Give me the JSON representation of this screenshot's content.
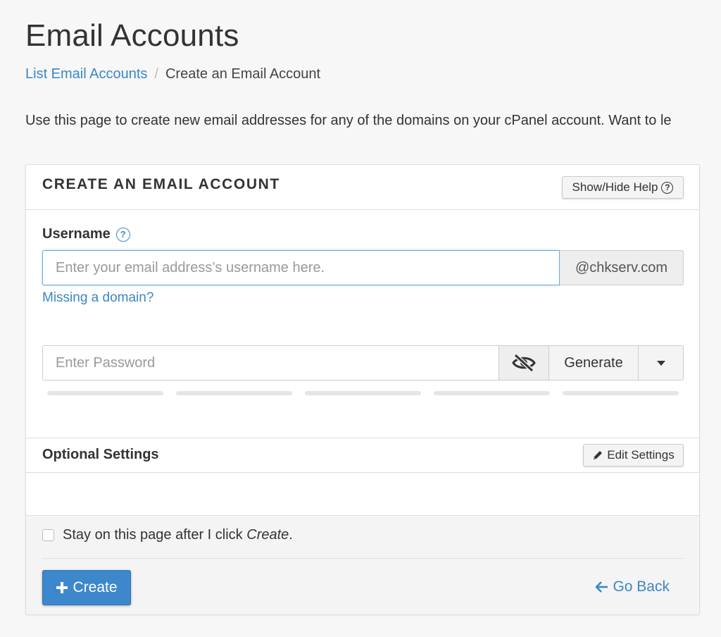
{
  "page": {
    "title": "Email Accounts",
    "breadcrumb": {
      "link_label": "List Email Accounts",
      "separator": "/",
      "current_label": "Create an Email Account"
    },
    "intro": "Use this page to create new email addresses for any of the domains on your cPanel account. Want to le"
  },
  "card": {
    "title": "CREATE AN EMAIL ACCOUNT",
    "help_button_label": "Show/Hide Help",
    "help_icon_glyph": "?",
    "username": {
      "label": "Username",
      "placeholder": "Enter your email address’s username here.",
      "value": "",
      "domain": "@chkserv.com",
      "missing_domain_link": "Missing a domain?"
    },
    "password": {
      "placeholder": "Enter Password",
      "value": "",
      "visibility_icon": "eye-slash-icon",
      "generate_label": "Generate",
      "strength_segments": 5,
      "strength_level": 0
    },
    "optional_settings": {
      "title": "Optional Settings",
      "edit_label": "Edit Settings",
      "edit_icon": "pencil-icon"
    },
    "footer": {
      "stay_label_prefix": "Stay on this page after I click ",
      "stay_label_emphasis": "Create",
      "stay_label_suffix": ".",
      "stay_checked": false,
      "create_label": "Create",
      "go_back_label": "Go Back"
    }
  },
  "colors": {
    "link": "#3a87c6",
    "primary_button": "#3d87cc",
    "background": "#f7f7f7"
  }
}
